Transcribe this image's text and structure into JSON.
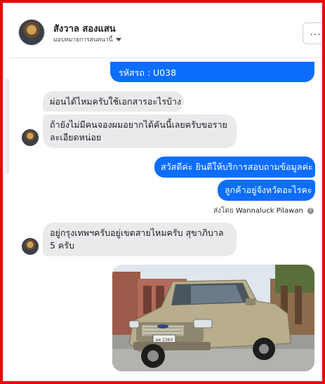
{
  "header": {
    "name": "สังวาล สองแสน",
    "assign_label": "มอบหมายการสนทนานี้",
    "more_label": "..."
  },
  "messages": [
    {
      "dir": "out",
      "text": "รหัสรถ : U038"
    },
    {
      "dir": "in",
      "text": "ผ่อนได้ไหมครับใช้เอกสารอะไรบ้าง"
    },
    {
      "dir": "in",
      "text": "ถ้ายังไม่มีคนจองผมอยากได้คันนี้เลยครับขอรายละเอียดหน่อย"
    },
    {
      "dir": "out",
      "text": "สวัสดีค่ะ  ยินดีให้บริการสอบถามข้อมูลค่ะ"
    },
    {
      "dir": "out",
      "text": "ลูกค้าอยู่จังหวัดอะไรคะ"
    },
    {
      "dir": "in",
      "text": "อยู่กรุงเทพฯครับอยู่เขตสายไหมครับ สุขาภิบาล 5 ครับ"
    }
  ],
  "sent_by": {
    "prefix": "ส่งโดย",
    "name": "Wannaluck Pilawan",
    "help_icon": "question-circle-icon"
  },
  "photo": {
    "description_icon": "car-photo",
    "plate": "ผท 2364"
  }
}
